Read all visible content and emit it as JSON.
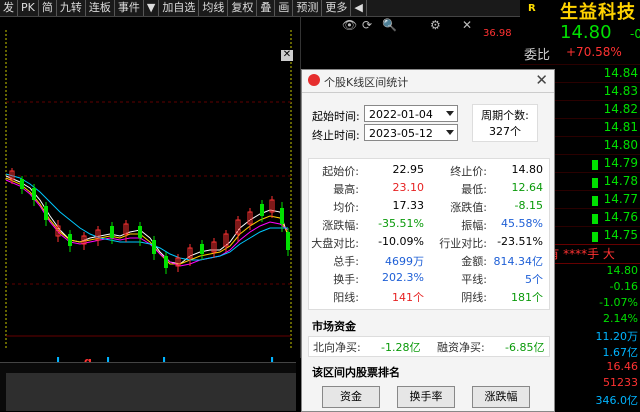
{
  "toolbar": {
    "items": [
      "发",
      "PK",
      "简",
      "九转",
      "连板",
      "事件",
      "▼",
      "加自选",
      "均线",
      "复权",
      "叠",
      "画",
      "预测",
      "更多",
      "◀"
    ]
  },
  "chart": {
    "top_icons": [
      "👁",
      "⟳",
      "🔍",
      "⚙",
      "✕"
    ],
    "price_mark": "36.98",
    "close_label": "✕",
    "markers": [
      {
        "text": "L",
        "color": "#00b4ff"
      },
      {
        "text": "q",
        "color": "#ff3232"
      },
      {
        "text": "L",
        "color": "#00b4ff"
      },
      {
        "text": "L",
        "color": "#00b4ff"
      },
      {
        "text": "L",
        "color": "#00b4ff"
      },
      {
        "text": "L",
        "color": "#00b4ff"
      }
    ]
  },
  "right_panel": {
    "flag": "R",
    "stock_name": "生益科技",
    "price": "14.80",
    "change": "-0.",
    "weibi_label": "委比",
    "weibi_value": "+70.58%",
    "ask_prices": [
      "14.84",
      "14.83",
      "14.82",
      "14.81",
      "14.80"
    ],
    "bid_prices": [
      "14.79",
      "14.78",
      "14.77",
      "14.76",
      "14.75"
    ],
    "middle": "70元有 ****手 大",
    "stats": [
      {
        "label": "",
        "value": "14.80",
        "color": "#00e000"
      },
      {
        "label": "跌",
        "value": "-0.16",
        "color": "#00e000"
      },
      {
        "label": "幅",
        "value": "-1.07%",
        "color": "#00e000"
      },
      {
        "label": "幅",
        "value": "2.14%",
        "color": "#00e000"
      },
      {
        "label": "",
        "value": "11.20万",
        "color": "#00b4ff"
      },
      {
        "label": "额",
        "value": "1.67亿",
        "color": "#00b4ff"
      },
      {
        "label": "",
        "value": "16.46",
        "color": "#ff3232"
      },
      {
        "label": "市",
        "value": "51233",
        "color": "#ff3232"
      },
      {
        "label": "市值",
        "value": "346.0亿",
        "color": "#00b4ff"
      }
    ]
  },
  "dialog": {
    "title": "个股K线区间统计",
    "close": "✕",
    "start_label": "起始时间:",
    "start_value": "2022-01-04",
    "end_label": "终止时间:",
    "end_value": "2023-05-12",
    "period_count_label": "周期个数:",
    "period_count_value": "327个",
    "stats": [
      {
        "k1": "起始价:",
        "v1": "22.95",
        "c1": "black",
        "k2": "终止价:",
        "v2": "14.80",
        "c2": "black"
      },
      {
        "k1": "最高:",
        "v1": "23.10",
        "c1": "red",
        "k2": "最低:",
        "v2": "12.64",
        "c2": "green"
      },
      {
        "k1": "均价:",
        "v1": "17.33",
        "c1": "black",
        "k2": "涨跌值:",
        "v2": "-8.15",
        "c2": "green"
      },
      {
        "k1": "涨跌幅:",
        "v1": "-35.51%",
        "c1": "green",
        "k2": "振幅:",
        "v2": "45.58%",
        "c2": "blue"
      },
      {
        "k1": "大盘对比:",
        "v1": "-10.09%",
        "c1": "black",
        "k2": "行业对比:",
        "v2": "-23.51%",
        "c2": "black"
      },
      {
        "k1": "总手:",
        "v1": "4699万",
        "c1": "blue",
        "k2": "金额:",
        "v2": "814.34亿",
        "c2": "blue"
      },
      {
        "k1": "换手:",
        "v1": "202.3%",
        "c1": "blue",
        "k2": "平线:",
        "v2": "5个",
        "c2": "blue"
      },
      {
        "k1": "阳线:",
        "v1": "141个",
        "c1": "red",
        "k2": "阴线:",
        "v2": "181个",
        "c2": "green"
      }
    ],
    "market_funds_title": "市场资金",
    "north_label": "北向净买:",
    "north_value": "-1.28亿",
    "margin_label": "融资净买:",
    "margin_value": "-6.85亿",
    "ranking_title": "该区间内股票排名",
    "buttons": [
      "资金",
      "换手率",
      "涨跌幅"
    ]
  }
}
